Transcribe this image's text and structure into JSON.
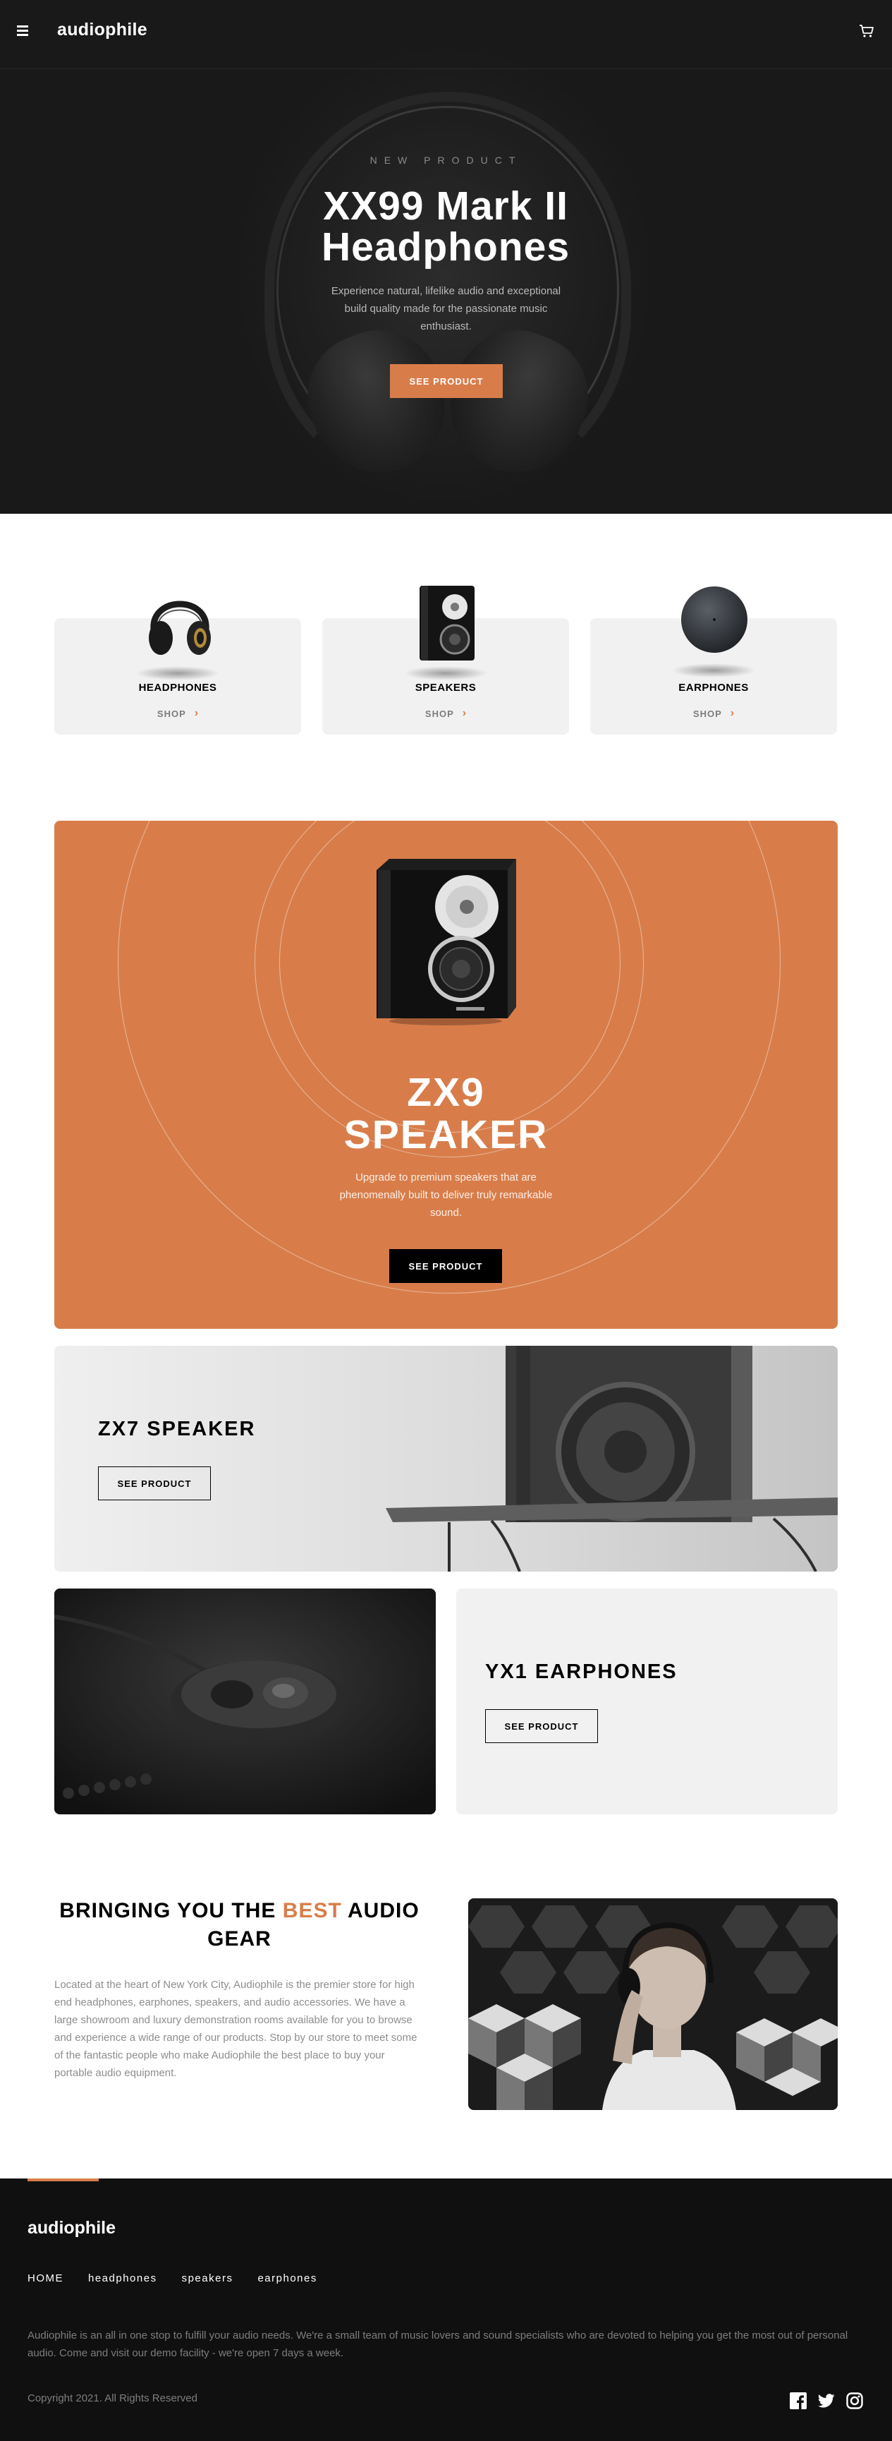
{
  "header": {
    "logo": "audiophile",
    "menu_icon": "hamburger-menu-icon",
    "cart_icon": "cart-icon"
  },
  "hero": {
    "overline": "NEW PRODUCT",
    "title": "XX99 Mark II Headphones",
    "description": "Experience natural, lifelike audio and exceptional build quality made for the passionate music enthusiast.",
    "button": "SEE PRODUCT"
  },
  "categories": [
    {
      "label": "HEADPHONES",
      "shop": "SHOP"
    },
    {
      "label": "SPEAKERS",
      "shop": "SHOP"
    },
    {
      "label": "EARPHONES",
      "shop": "SHOP"
    }
  ],
  "zx9": {
    "title_line1": "ZX9",
    "title_line2": "SPEAKER",
    "description": "Upgrade to premium speakers that are phenomenally built to deliver truly remarkable sound.",
    "button": "SEE PRODUCT"
  },
  "zx7": {
    "title": "ZX7 SPEAKER",
    "button": "SEE PRODUCT"
  },
  "yx1": {
    "title": "YX1 EARPHONES",
    "button": "SEE PRODUCT"
  },
  "about": {
    "title_before": "BRINGING YOU THE ",
    "title_accent": "BEST",
    "title_after": " AUDIO GEAR",
    "text": "Located at the heart of New York City, Audiophile is the premier store for high end headphones, earphones, speakers, and audio accessories. We have a large showroom and luxury demonstration rooms available for you to browse and experience a wide range of our products. Stop by our store to meet some of the fantastic people who make Audiophile the best place to buy your portable audio equipment."
  },
  "footer": {
    "logo": "audiophile",
    "nav": [
      "HOME",
      "headphones",
      "speakers",
      "earphones"
    ],
    "description": "Audiophile is an all in one stop to fulfill your audio needs. We're a small team of music lovers and sound specialists who are devoted to helping you get the most out of personal audio. Come and visit our demo facility - we're open 7 days a week.",
    "copyright": "Copyright 2021. All Rights Reserved",
    "social_icons": [
      "facebook-icon",
      "twitter-icon",
      "instagram-icon"
    ]
  },
  "colors": {
    "accent": "#d87d4a",
    "dark": "#191919",
    "light_gray": "#f1f1f1"
  }
}
